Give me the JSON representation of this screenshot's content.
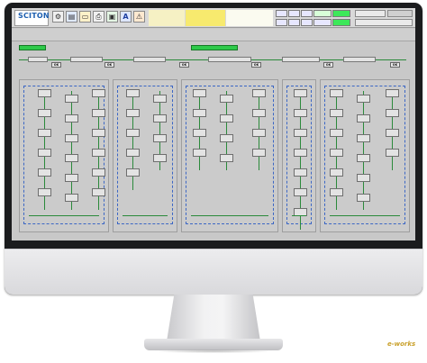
{
  "toolbar": {
    "logo": "SCITON",
    "logo_sub": "",
    "icons": [
      "settings-icon",
      "chart-icon",
      "folder-icon",
      "printer-icon",
      "save-icon",
      "text-icon",
      "warning-icon"
    ],
    "alarm_lines": [
      "",
      "",
      "",
      ""
    ],
    "nav_top": [
      "",
      "",
      "",
      "",
      ""
    ],
    "nav_bottom": [
      "",
      "",
      "",
      "",
      ""
    ],
    "status": [
      "",
      ""
    ]
  },
  "measurements": {
    "headers": [
      "",
      "",
      "",
      "",
      "",
      "",
      "",
      "",
      "",
      "",
      "",
      "",
      "",
      "",
      "",
      "",
      "",
      "",
      "",
      ""
    ],
    "values": [
      "",
      "",
      "",
      "",
      "",
      "",
      "",
      "",
      "",
      "",
      "",
      "",
      "",
      "",
      "",
      "",
      "",
      "",
      "",
      ""
    ]
  },
  "sequence": {
    "green_tags": [
      "",
      ""
    ],
    "plain_tags": [
      "",
      "",
      "",
      "",
      "",
      ""
    ],
    "ok_labels": [
      "OK",
      "OK",
      "OK",
      "OK",
      "OK",
      "OK"
    ]
  },
  "panels": [
    {
      "nodes": 18
    },
    {
      "nodes": 9
    },
    {
      "nodes": 12
    },
    {
      "nodes": 7
    },
    {
      "nodes": 16
    }
  ],
  "watermark": "e-works",
  "colors": {
    "accent": "#2ec94a",
    "frame": "#3b66c4",
    "logo": "#1d5fb0"
  }
}
